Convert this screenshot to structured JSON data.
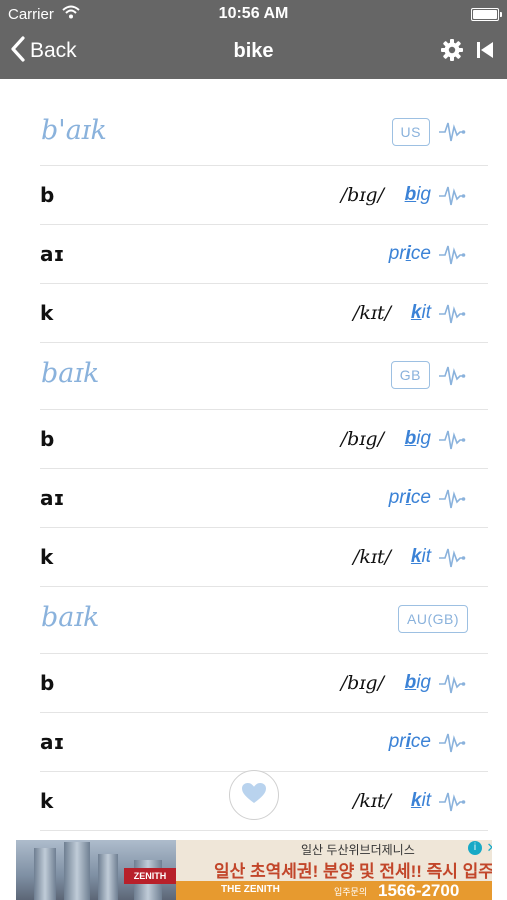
{
  "status_bar": {
    "carrier": "Carrier",
    "time": "10:56 AM"
  },
  "nav": {
    "back_label": "Back",
    "title": "bike"
  },
  "sections": [
    {
      "ipa": "b'aɪk",
      "badge": "US",
      "rows": [
        {
          "symbol": "b",
          "example_ipa": "/bɪg/",
          "word_pre": "",
          "word_hl": "b",
          "word_post": "ig"
        },
        {
          "symbol": "aɪ",
          "example_ipa": "",
          "word_pre": "pr",
          "word_hl": "i",
          "word_post": "ce"
        },
        {
          "symbol": "k",
          "example_ipa": "/kɪt/",
          "word_pre": "",
          "word_hl": "k",
          "word_post": "it"
        }
      ]
    },
    {
      "ipa": "baɪk",
      "badge": "GB",
      "rows": [
        {
          "symbol": "b",
          "example_ipa": "/bɪg/",
          "word_pre": "",
          "word_hl": "b",
          "word_post": "ig"
        },
        {
          "symbol": "aɪ",
          "example_ipa": "",
          "word_pre": "pr",
          "word_hl": "i",
          "word_post": "ce"
        },
        {
          "symbol": "k",
          "example_ipa": "/kɪt/",
          "word_pre": "",
          "word_hl": "k",
          "word_post": "it"
        }
      ]
    },
    {
      "ipa": "baɪk",
      "badge": "AU(GB)",
      "rows": [
        {
          "symbol": "b",
          "example_ipa": "/bɪg/",
          "word_pre": "",
          "word_hl": "b",
          "word_post": "ig"
        },
        {
          "symbol": "aɪ",
          "example_ipa": "",
          "word_pre": "pr",
          "word_hl": "i",
          "word_post": "ce"
        },
        {
          "symbol": "k",
          "example_ipa": "/kɪt/",
          "word_pre": "",
          "word_hl": "k",
          "word_post": "it"
        }
      ]
    }
  ],
  "icons": {
    "back": "chevron-left-icon",
    "settings": "gear-icon",
    "skip": "skip-back-icon",
    "audio": "waveform-icon",
    "favorite": "heart-icon"
  },
  "ad": {
    "top_text": "일산 두산위브더제니스",
    "main_text": "일산 초역세권! 분양 및 전세!! 즉시 입주",
    "brand": "THE ZENITH",
    "logo_text": "ZENITH",
    "contact_label": "입주문의",
    "phone": "1566-2700"
  },
  "colors": {
    "nav_bg": "#666666",
    "accent_light": "#8ab2dc",
    "link_blue": "#3b82d6"
  }
}
